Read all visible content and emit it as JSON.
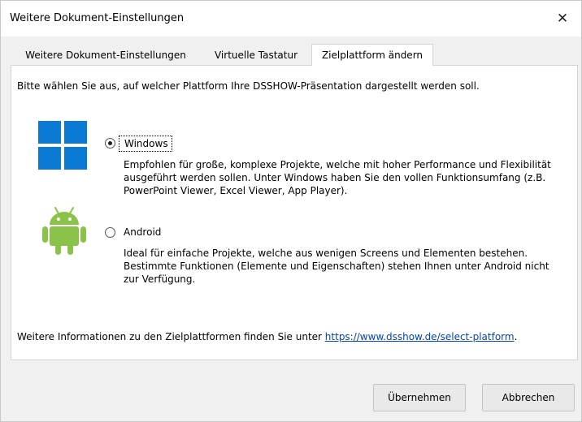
{
  "window": {
    "title": "Weitere Dokument-Einstellungen",
    "close_glyph": "✕"
  },
  "tabs": [
    {
      "label": "Weitere Dokument-Einstellungen",
      "active": false
    },
    {
      "label": "Virtuelle Tastatur",
      "active": false
    },
    {
      "label": "Zielplattform ändern",
      "active": true
    }
  ],
  "content": {
    "intro": "Bitte wählen Sie aus, auf welcher Plattform Ihre DSSHOW-Präsentation dargestellt werden soll.",
    "options": [
      {
        "label": "Windows",
        "selected": true,
        "icon": "windows-logo-icon",
        "description_lines": [
          "Empfohlen für große, komplexe Projekte, welche mit hoher Performance und Flexibilität",
          "ausgeführt werden sollen. Unter Windows haben Sie den vollen Funktionsumfang (z.B.",
          "PowerPoint Viewer, Excel Viewer, App Player)."
        ]
      },
      {
        "label": "Android",
        "selected": false,
        "icon": "android-logo-icon",
        "description_lines": [
          "Ideal für einfache Projekte, welche aus wenigen Screens und Elementen bestehen.",
          "Bestimmte Funktionen (Elemente und Eigenschaften) stehen Ihnen unter Android nicht",
          "zur Verfügung."
        ]
      }
    ],
    "info_text": "Weitere Informationen zu den Zielplattformen finden Sie unter ",
    "info_link": "https://www.dsshow.de/select-platform",
    "info_suffix": "."
  },
  "buttons": {
    "apply": "Übernehmen",
    "cancel": "Abbrechen"
  },
  "colors": {
    "windows_blue": "#0a7ad4",
    "android_green": "#8bc34a",
    "link": "#0645ad"
  }
}
